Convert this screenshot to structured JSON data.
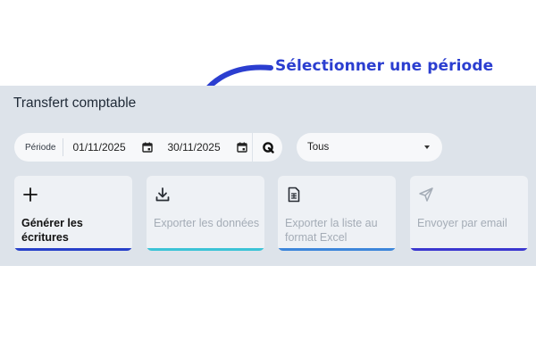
{
  "annotation": {
    "text": "Sélectionner une période"
  },
  "panel": {
    "title": "Transfert comptable"
  },
  "period": {
    "label": "Période",
    "start_date": "01/11/2025",
    "end_date": "30/11/2025"
  },
  "filter": {
    "selected": "Tous"
  },
  "actions": [
    {
      "label": "Générer les écritures",
      "icon": "plus-icon",
      "enabled": true,
      "bar_color": "#2740c9"
    },
    {
      "label": "Exporter les données",
      "icon": "download-icon",
      "enabled": false,
      "bar_color": "#3cc3d6"
    },
    {
      "label": "Exporter la liste au format Excel",
      "icon": "spreadsheet-file-icon",
      "enabled": false,
      "bar_color": "#3d86da"
    },
    {
      "label": "Envoyer par email",
      "icon": "send-icon",
      "enabled": false,
      "bar_color": "#3b37cf"
    }
  ],
  "colors": {
    "accent": "#2b3ed0",
    "panel_background": "#dde3ea"
  }
}
